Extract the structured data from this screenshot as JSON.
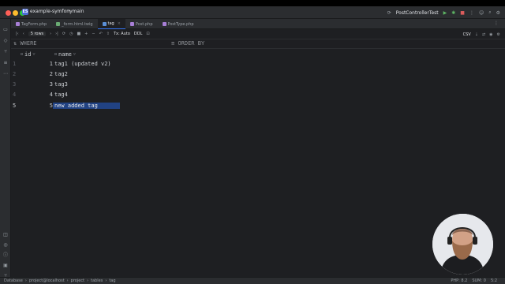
{
  "titlebar": {
    "project_badge": "ES",
    "project_name": "example-symfony",
    "branch": "main",
    "run_config": "PostControllerTest"
  },
  "tabs": [
    {
      "label": "TagForm.php",
      "color": "#a87fd6"
    },
    {
      "label": "_form.html.twig",
      "color": "#6aab73"
    },
    {
      "label": "tag",
      "color": "#5b8fd6"
    },
    {
      "label": "Post.php",
      "color": "#a87fd6"
    },
    {
      "label": "PostType.php",
      "color": "#a87fd6"
    }
  ],
  "toolbar": {
    "rows_label": "5 rows",
    "tx_label": "Tx: Auto",
    "ddl_label": "DDL",
    "csv_label": "CSV"
  },
  "filter": {
    "where_label": "WHERE",
    "orderby_label": "ORDER BY"
  },
  "grid": {
    "columns": [
      "id",
      "name"
    ],
    "rows": [
      {
        "num": "1",
        "id": "1",
        "name": "tag1 (updated v2)"
      },
      {
        "num": "2",
        "id": "2",
        "name": "tag2"
      },
      {
        "num": "3",
        "id": "3",
        "name": "tag3"
      },
      {
        "num": "4",
        "id": "4",
        "name": "tag4"
      },
      {
        "num": "5",
        "id": "5",
        "name": "new added tag"
      }
    ]
  },
  "statusbar": {
    "crumbs": [
      "Database",
      "project@localhost",
      "project",
      "tables",
      "tag"
    ],
    "php": "PHP: 8.2",
    "sum": "SUM: 0",
    "pos": "5:2"
  }
}
